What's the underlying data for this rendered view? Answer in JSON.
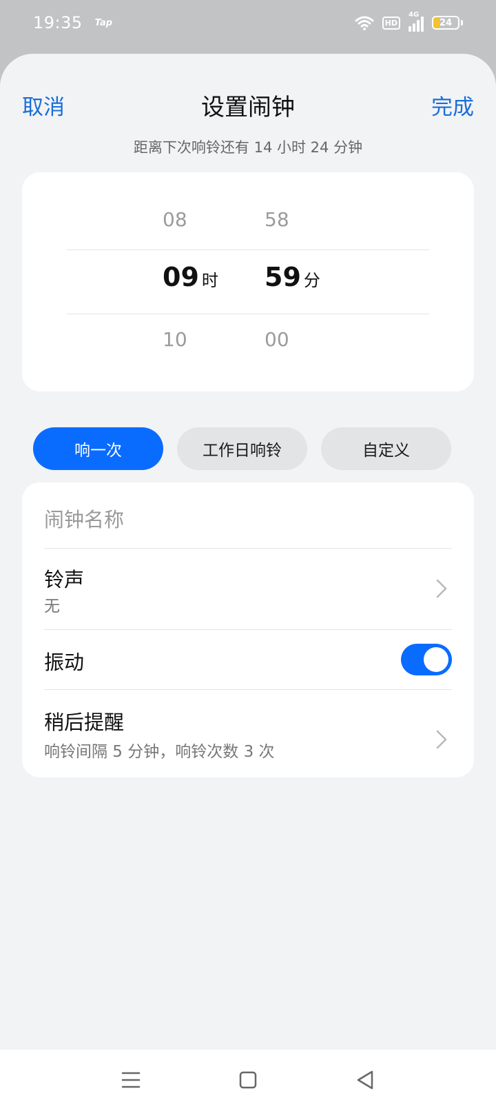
{
  "status_bar": {
    "time": "19:35",
    "tap_label": "Tap",
    "hd_label": "HD",
    "network_label": "4G",
    "battery_level": "24",
    "battery_fraction": 0.24,
    "icons": [
      "wifi-icon",
      "hd-icon",
      "signal-icon",
      "battery-icon"
    ]
  },
  "header": {
    "cancel_label": "取消",
    "title": "设置闹钟",
    "done_label": "完成",
    "subtitle": "距离下次响铃还有 14 小时 24 分钟"
  },
  "picker": {
    "hours": {
      "prev": "08",
      "current": "09",
      "next": "10",
      "unit": "时"
    },
    "minutes": {
      "prev": "58",
      "current": "59",
      "next": "00",
      "unit": "分"
    }
  },
  "repeat_options": [
    {
      "label": "响一次",
      "selected": true
    },
    {
      "label": "工作日响铃",
      "selected": false
    },
    {
      "label": "自定义",
      "selected": false
    }
  ],
  "settings": {
    "name_placeholder": "闹钟名称",
    "name_value": "",
    "ringtone": {
      "title": "铃声",
      "value": "无"
    },
    "vibration": {
      "title": "振动",
      "enabled": true
    },
    "snooze": {
      "title": "稍后提醒",
      "value": "响铃间隔 5 分钟，响铃次数 3 次"
    }
  },
  "colors": {
    "accent": "#0a6cff",
    "link": "#1a6fd6",
    "background": "#f2f3f5",
    "battery_fill": "#f2c230"
  },
  "nav_bar": {
    "icons": [
      "menu-icon",
      "home-icon",
      "back-icon"
    ]
  }
}
